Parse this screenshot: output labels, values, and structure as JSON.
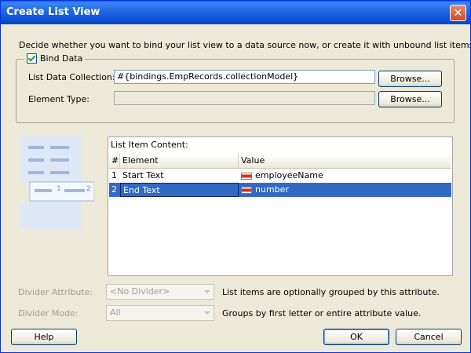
{
  "window": {
    "title": "Create List View",
    "close_glyph": "✕"
  },
  "description": "Decide whether you want to bind your list view to a data source now, or create it with unbound list items.",
  "bind_data": {
    "checkbox_label": "Bind Data",
    "checked": true,
    "list_data_collection": {
      "label": "List Data Collection:",
      "value": "#{bindings.EmpRecords.collectionModel}",
      "browse_label": "Browse..."
    },
    "element_type": {
      "label": "Element Type:",
      "value": "",
      "browse_label": "Browse..."
    }
  },
  "illustration": {
    "item_label_1": "1",
    "item_label_2": "2"
  },
  "list_item_content": {
    "caption": "List Item Content:",
    "columns": [
      "#",
      "Element",
      "Value"
    ],
    "rows": [
      {
        "index": "1",
        "element": "Start Text",
        "value": "employeeName",
        "selected": false
      },
      {
        "index": "2",
        "element": "End Text",
        "value": "number",
        "selected": true
      }
    ],
    "value_icon": "variable-icon"
  },
  "divider_attribute": {
    "label": "Divider Attribute:",
    "value": "<No Divider>",
    "hint": "List items are optionally grouped by this attribute."
  },
  "divider_mode": {
    "label": "Divider Mode:",
    "value": "All",
    "hint": "Groups by first letter or entire attribute value."
  },
  "buttons": {
    "help": "Help",
    "ok": "OK",
    "cancel": "Cancel"
  },
  "colors": {
    "selection": "#316ac5",
    "titlebar": "#0b52d6",
    "dialog_bg": "#ece9d8"
  }
}
